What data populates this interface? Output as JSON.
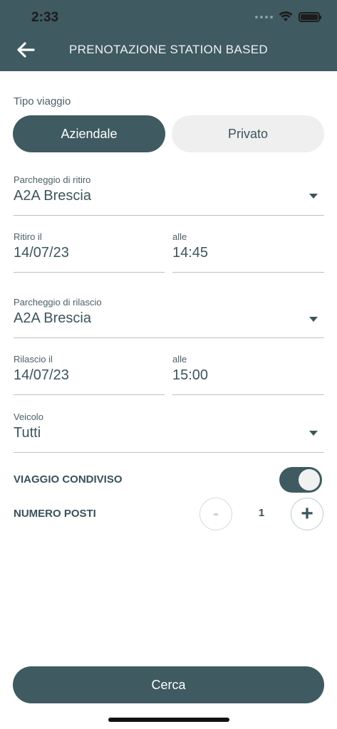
{
  "status_bar": {
    "time": "2:33"
  },
  "header": {
    "title": "PRENOTAZIONE STATION BASED",
    "back_icon": "arrow-left-icon"
  },
  "trip_type": {
    "label": "Tipo viaggio",
    "options": [
      "Aziendale",
      "Privato"
    ],
    "selected": "Aziendale"
  },
  "pickup_parking": {
    "label": "Parcheggio di ritiro",
    "value": "A2A Brescia"
  },
  "pickup_date": {
    "label": "Ritiro il",
    "value": "14/07/23"
  },
  "pickup_time": {
    "label": "alle",
    "value": "14:45"
  },
  "return_parking": {
    "label": "Parcheggio di rilascio",
    "value": "A2A Brescia"
  },
  "return_date": {
    "label": "Rilascio il",
    "value": "14/07/23"
  },
  "return_time": {
    "label": "alle",
    "value": "15:00"
  },
  "vehicle": {
    "label": "Veicolo",
    "value": "Tutti"
  },
  "shared_trip": {
    "label": "VIAGGIO CONDIVISO",
    "enabled": true
  },
  "seats": {
    "label": "NUMERO POSTI",
    "value": "1",
    "minus": "-",
    "plus": "+"
  },
  "search_button": {
    "label": "Cerca"
  },
  "colors": {
    "primary": "#3f5a61",
    "inactive": "#efefef",
    "text": "#3c555c"
  }
}
